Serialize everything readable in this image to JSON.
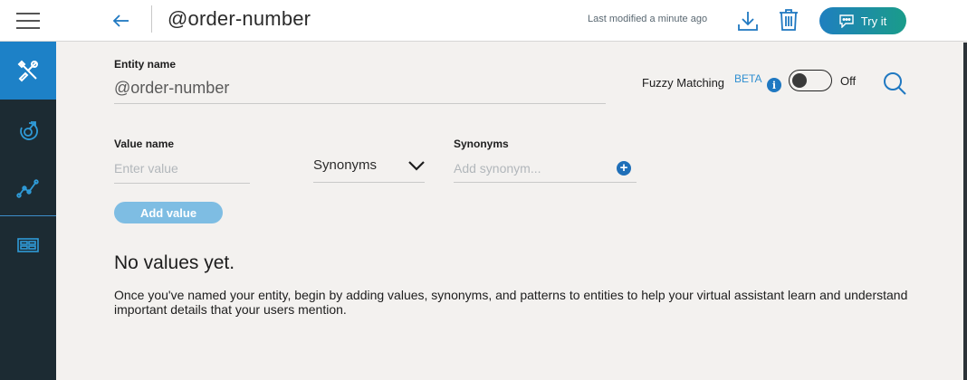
{
  "header": {
    "title": "@order-number",
    "last_modified": "Last modified a minute ago",
    "try_label": "Try it"
  },
  "sidebar": {
    "items": [
      {
        "icon": "tools-icon",
        "active": true
      },
      {
        "icon": "intents-icon",
        "active": false
      },
      {
        "icon": "analytics-icon",
        "active": false
      },
      {
        "icon": "dashboard-icon",
        "active": false
      }
    ]
  },
  "entity": {
    "label": "Entity name",
    "value": "@order-number"
  },
  "fuzzy": {
    "label": "Fuzzy Matching",
    "beta": "BETA",
    "state": "Off"
  },
  "value_form": {
    "value_label": "Value name",
    "value_placeholder": "Enter value",
    "type_selected": "Synonyms",
    "synonyms_label": "Synonyms",
    "synonyms_placeholder": "Add synonym...",
    "add_button": "Add value"
  },
  "empty": {
    "title": "No values yet.",
    "description": "Once you've named your entity, begin by adding values, synonyms, and patterns to entities to help your virtual assistant learn and understand important details that your users mention."
  },
  "colors": {
    "accent": "#1d81c7",
    "sidebar_bg": "#1c2b33",
    "try_gradient_start": "#1f7fbf",
    "try_gradient_end": "#1a9c8a"
  }
}
